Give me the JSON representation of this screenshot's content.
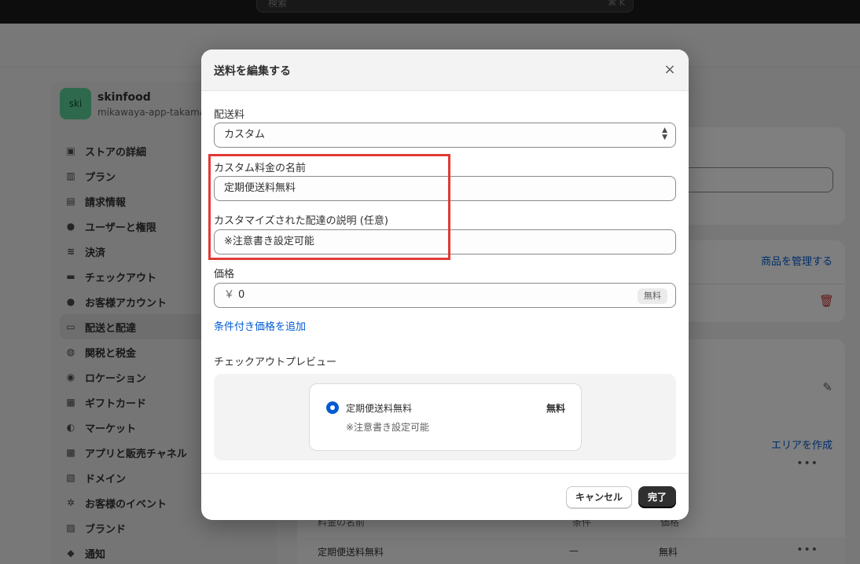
{
  "search": {
    "placeholder": "検索",
    "shortcut": "⌘ K"
  },
  "store": {
    "logo_text": "ski",
    "name": "skinfood",
    "domain": "mikawaya-app-takama"
  },
  "sidebar": {
    "items": [
      {
        "label": "ストアの詳細",
        "icon": "store-icon",
        "glyph": "▣"
      },
      {
        "label": "プラン",
        "icon": "plan-icon",
        "glyph": "▥"
      },
      {
        "label": "請求情報",
        "icon": "billing-icon",
        "glyph": "▤"
      },
      {
        "label": "ユーザーと権限",
        "icon": "users-icon",
        "glyph": "●"
      },
      {
        "label": "決済",
        "icon": "payments-icon",
        "glyph": "≋"
      },
      {
        "label": "チェックアウト",
        "icon": "cart-icon",
        "glyph": "▬"
      },
      {
        "label": "お客様アカウント",
        "icon": "customer-icon",
        "glyph": "●"
      },
      {
        "label": "配送と配達",
        "icon": "truck-icon",
        "glyph": "▭"
      },
      {
        "label": "関税と税金",
        "icon": "tax-icon",
        "glyph": "◍"
      },
      {
        "label": "ロケーション",
        "icon": "location-icon",
        "glyph": "◉"
      },
      {
        "label": "ギフトカード",
        "icon": "gift-card-icon",
        "glyph": "▦"
      },
      {
        "label": "マーケット",
        "icon": "globe-icon",
        "glyph": "◐"
      },
      {
        "label": "アプリと販売チャネル",
        "icon": "apps-icon",
        "glyph": "▩"
      },
      {
        "label": "ドメイン",
        "icon": "domain-icon",
        "glyph": "▧"
      },
      {
        "label": "お客様のイベント",
        "icon": "events-icon",
        "glyph": "✲"
      },
      {
        "label": "ブランド",
        "icon": "brand-icon",
        "glyph": "▨"
      },
      {
        "label": "通知",
        "icon": "bell-icon",
        "glyph": "◆"
      }
    ],
    "active_index": 7
  },
  "background": {
    "manage_products_link": "商品を管理する",
    "create_area_link": "エリアを作成",
    "table_header_name": "料金の名前",
    "table_header_condition": "条件",
    "table_header_price": "価格",
    "row_name": "定期便送料無料",
    "row_condition": "—",
    "row_price": "無料"
  },
  "modal": {
    "title": "送料を編集する",
    "shipping_rate_label": "配送料",
    "shipping_rate_value": "カスタム",
    "custom_name_label": "カスタム料金の名前",
    "custom_name_value": "定期便送料無料",
    "description_label": "カスタマイズされた配達の説明 (任意)",
    "description_value": "※注意書き設定可能",
    "price_label": "価格",
    "currency_symbol": "￥",
    "price_value": "0",
    "free_badge": "無料",
    "add_conditional_link": "条件付き価格を追加",
    "preview_label": "チェックアウトプレビュー",
    "preview": {
      "name": "定期便送料無料",
      "price": "無料",
      "note": "※注意書き設定可能"
    },
    "cancel_label": "キャンセル",
    "done_label": "完了"
  },
  "colors": {
    "accent": "#005bd3",
    "highlight_box": "#e03a35",
    "primary_button": "#303030"
  }
}
